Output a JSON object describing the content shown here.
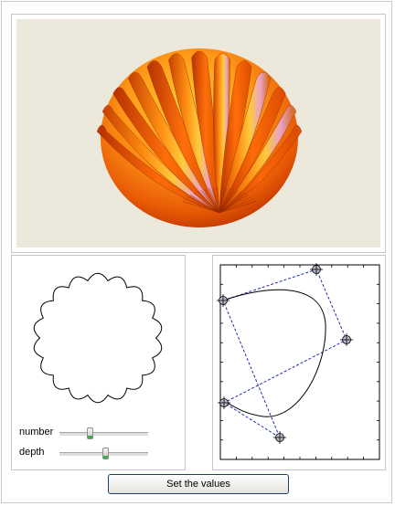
{
  "controls": {
    "number": {
      "label": "number",
      "value_fraction": 0.33
    },
    "depth": {
      "label": "depth",
      "value_fraction": 0.52
    }
  },
  "button": {
    "label": "Set the values"
  },
  "colors": {
    "viewer_bg": "#ece9dc",
    "surface_dark": "#c03a00",
    "surface_mid": "#ff7a10",
    "surface_light": "#ffd23a",
    "highlight": "#e6a0e6",
    "control_polygon": "#1a2fb0",
    "slider_accent": "#33b246"
  }
}
